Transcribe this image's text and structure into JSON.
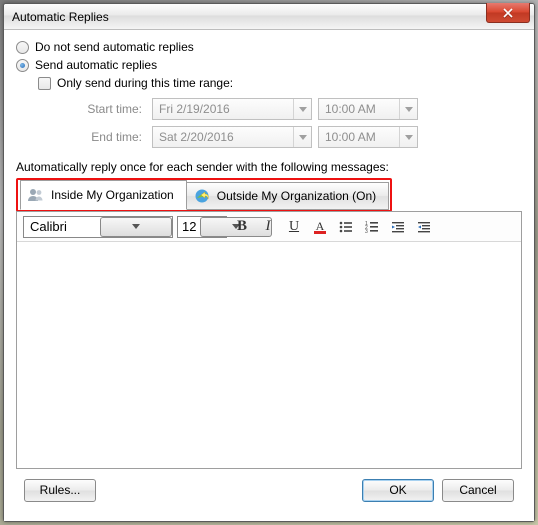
{
  "window": {
    "title": "Automatic Replies"
  },
  "options": {
    "no_send_label": "Do not send automatic replies",
    "send_label": "Send automatic replies",
    "time_range_label": "Only send during this time range:",
    "start_label": "Start time:",
    "end_label": "End time:",
    "start_date": "Fri 2/19/2016",
    "start_time": "10:00 AM",
    "end_date": "Sat 2/20/2016",
    "end_time": "10:00 AM",
    "selected": "send",
    "time_range_checked": false
  },
  "section_label": "Automatically reply once for each sender with the following messages:",
  "tabs": {
    "inside_label": "Inside My Organization",
    "outside_label": "Outside My Organization (On)",
    "active": "inside"
  },
  "editor": {
    "font_name": "Calibri",
    "font_size": "12",
    "body": ""
  },
  "buttons": {
    "rules": "Rules...",
    "ok": "OK",
    "cancel": "Cancel"
  },
  "colors": {
    "highlight": "#e11111",
    "accent": "#2a6db9"
  }
}
